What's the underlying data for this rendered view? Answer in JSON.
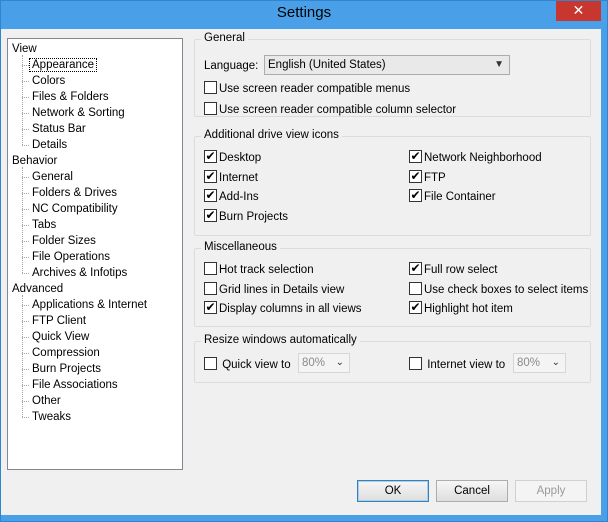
{
  "window": {
    "title": "Settings",
    "close_glyph": "✕"
  },
  "tree": [
    {
      "label": "View",
      "level": 0,
      "selected": false,
      "name": "tree-item-view"
    },
    {
      "label": "Appearance",
      "level": 1,
      "selected": true,
      "name": "tree-item-appearance"
    },
    {
      "label": "Colors",
      "level": 1,
      "selected": false,
      "name": "tree-item-colors"
    },
    {
      "label": "Files & Folders",
      "level": 1,
      "selected": false,
      "name": "tree-item-files-folders"
    },
    {
      "label": "Network & Sorting",
      "level": 1,
      "selected": false,
      "name": "tree-item-network-sorting"
    },
    {
      "label": "Status Bar",
      "level": 1,
      "selected": false,
      "name": "tree-item-status-bar"
    },
    {
      "label": "Details",
      "level": 1,
      "selected": false,
      "name": "tree-item-details"
    },
    {
      "label": "Behavior",
      "level": 0,
      "selected": false,
      "name": "tree-item-behavior"
    },
    {
      "label": "General",
      "level": 1,
      "selected": false,
      "name": "tree-item-general"
    },
    {
      "label": "Folders & Drives",
      "level": 1,
      "selected": false,
      "name": "tree-item-folders-drives"
    },
    {
      "label": "NC Compatibility",
      "level": 1,
      "selected": false,
      "name": "tree-item-nc-compatibility"
    },
    {
      "label": "Tabs",
      "level": 1,
      "selected": false,
      "name": "tree-item-tabs"
    },
    {
      "label": "Folder Sizes",
      "level": 1,
      "selected": false,
      "name": "tree-item-folder-sizes"
    },
    {
      "label": "File Operations",
      "level": 1,
      "selected": false,
      "name": "tree-item-file-operations"
    },
    {
      "label": "Archives & Infotips",
      "level": 1,
      "selected": false,
      "name": "tree-item-archives-infotips"
    },
    {
      "label": "Advanced",
      "level": 0,
      "selected": false,
      "name": "tree-item-advanced"
    },
    {
      "label": "Applications & Internet",
      "level": 1,
      "selected": false,
      "name": "tree-item-applications-internet"
    },
    {
      "label": "FTP Client",
      "level": 1,
      "selected": false,
      "name": "tree-item-ftp-client"
    },
    {
      "label": "Quick View",
      "level": 1,
      "selected": false,
      "name": "tree-item-quick-view"
    },
    {
      "label": "Compression",
      "level": 1,
      "selected": false,
      "name": "tree-item-compression"
    },
    {
      "label": "Burn Projects",
      "level": 1,
      "selected": false,
      "name": "tree-item-burn-projects"
    },
    {
      "label": "File Associations",
      "level": 1,
      "selected": false,
      "name": "tree-item-file-associations"
    },
    {
      "label": "Other",
      "level": 1,
      "selected": false,
      "name": "tree-item-other"
    },
    {
      "label": "Tweaks",
      "level": 1,
      "selected": false,
      "name": "tree-item-tweaks"
    }
  ],
  "general": {
    "title": "General",
    "language_label": "Language:",
    "language_value": "English (United States)",
    "options": [
      {
        "label": "Use screen reader compatible menus",
        "checked": false,
        "name": "screen-reader-menus-checkbox"
      },
      {
        "label": "Use screen reader compatible column selector",
        "checked": false,
        "name": "screen-reader-column-checkbox"
      }
    ]
  },
  "drive_icons": {
    "title": "Additional drive view icons",
    "left": [
      {
        "label": "Desktop",
        "checked": true,
        "name": "desktop-checkbox"
      },
      {
        "label": "Internet",
        "checked": true,
        "name": "internet-checkbox"
      },
      {
        "label": "Add-Ins",
        "checked": true,
        "name": "add-ins-checkbox"
      },
      {
        "label": "Burn Projects",
        "checked": true,
        "name": "burn-projects-checkbox"
      }
    ],
    "right": [
      {
        "label": "Network Neighborhood",
        "checked": true,
        "name": "network-neighborhood-checkbox"
      },
      {
        "label": "FTP",
        "checked": true,
        "name": "ftp-checkbox"
      },
      {
        "label": "File Container",
        "checked": true,
        "name": "file-container-checkbox"
      }
    ]
  },
  "misc": {
    "title": "Miscellaneous",
    "left": [
      {
        "label": "Hot track selection",
        "checked": false,
        "name": "hot-track-checkbox"
      },
      {
        "label": "Grid lines in Details view",
        "checked": false,
        "name": "grid-lines-checkbox"
      },
      {
        "label": "Display columns in all views",
        "checked": true,
        "name": "display-columns-checkbox"
      }
    ],
    "right": [
      {
        "label": "Full row select",
        "checked": true,
        "name": "full-row-select-checkbox"
      },
      {
        "label": "Use check boxes to select items",
        "checked": false,
        "name": "check-boxes-select-checkbox"
      },
      {
        "label": "Highlight hot item",
        "checked": true,
        "name": "highlight-hot-item-checkbox"
      }
    ]
  },
  "resize": {
    "title": "Resize windows automatically",
    "quick_view_label": "Quick view to",
    "quick_view_checked": false,
    "quick_view_value": "80%",
    "internet_view_label": "Internet view to",
    "internet_view_checked": false,
    "internet_view_value": "80%"
  },
  "buttons": {
    "ok": "OK",
    "cancel": "Cancel",
    "apply": "Apply"
  },
  "colors": {
    "titlebar": "#49a0e8",
    "close": "#c7372f",
    "dialog": "#f0f0f0"
  },
  "icons": {
    "checkmark": "✔",
    "dropdown": "chevron-down-icon"
  }
}
